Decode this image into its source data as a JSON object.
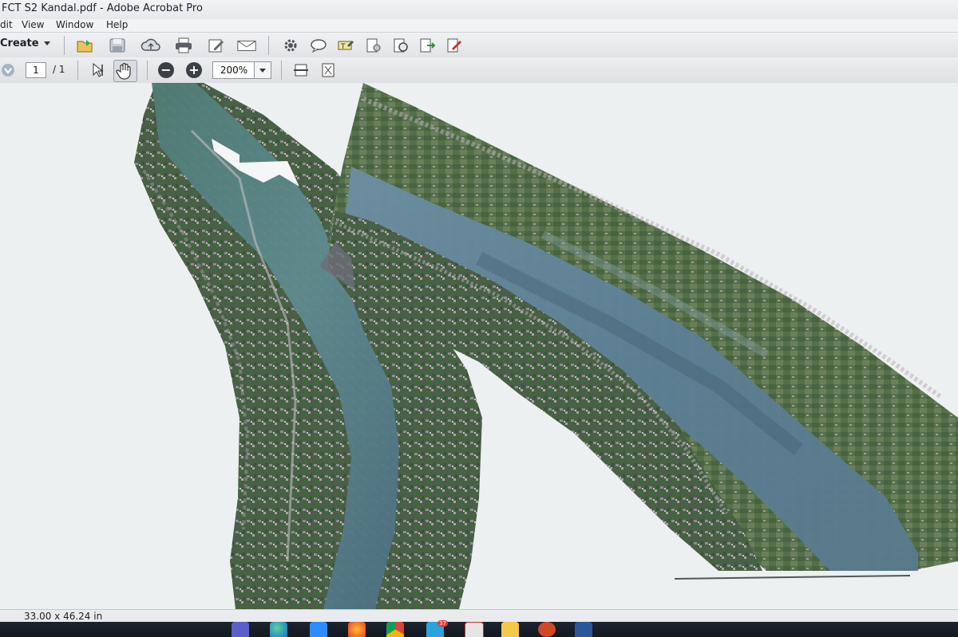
{
  "window": {
    "title": "FCT S2 Kandal.pdf - Adobe Acrobat Pro"
  },
  "menu": {
    "items": [
      "dit",
      "View",
      "Window",
      "Help"
    ]
  },
  "toolbar": {
    "create_label": "Create",
    "icons": [
      "open-icon",
      "save-icon",
      "cloud-upload-icon",
      "print-icon",
      "edit-icon",
      "email-icon",
      "settings-icon",
      "comment-icon",
      "stamp-icon",
      "attach-icon",
      "security-icon",
      "export-icon",
      "sign-icon"
    ]
  },
  "navigation": {
    "page_current": "1",
    "page_total": "/ 1",
    "zoom": "200%"
  },
  "document": {
    "content": "aerial orthomosaic map of river section",
    "water_color": "#5a7c86",
    "land_color": "#4a5a44",
    "background_color": "#edf0f1"
  },
  "status": {
    "page_size": "33.00 x 46.24 in"
  },
  "taskbar": {
    "apps": [
      "teams-icon",
      "edge-icon",
      "zoom-icon",
      "firefox-icon",
      "chrome-icon",
      "telegram-icon",
      "acrobat-icon",
      "file-explorer-icon",
      "powerpoint-icon",
      "word-icon"
    ],
    "telegram_badge": "37"
  }
}
